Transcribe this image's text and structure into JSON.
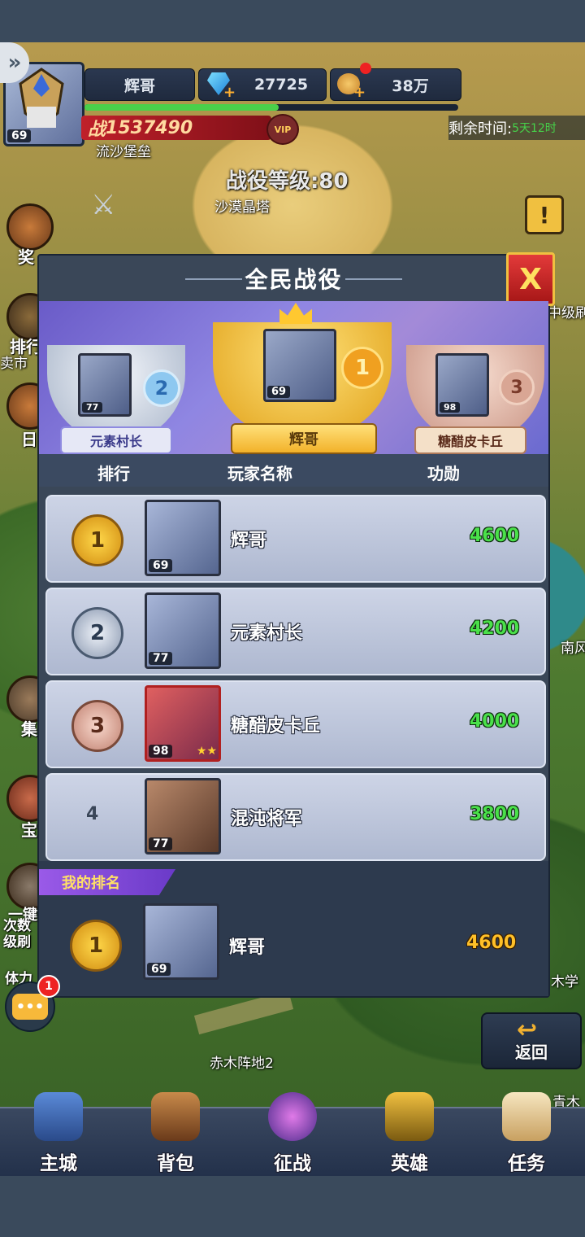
{
  "topbar": {
    "player_name": "辉哥",
    "player_level": "69",
    "diamonds": "27725",
    "gold": "38万",
    "power_prefix": "战",
    "power": "1537490",
    "vip_label": "VIP",
    "remaining_label": "剩余时间:",
    "remaining_value": "5天12时",
    "exp_progress_pct": 52
  },
  "map": {
    "labels": {
      "sand_fort": "流沙堡垒",
      "campaign_level": "战役等级:80",
      "desert_tower": "沙漠晶塔",
      "mid_level": "中级刷",
      "south": "南风",
      "wood_school": "木学",
      "red_wood": "赤木阵地2",
      "blue_wood": "青木",
      "sale": "卖市"
    },
    "left_side": [
      "奖",
      "排行",
      "日",
      "集",
      "宝",
      "一键",
      "次数级刷",
      "体力"
    ]
  },
  "dialog": {
    "title": "全民战役",
    "close_label": "X",
    "podium": [
      {
        "rank": 2,
        "name": "元素村长",
        "level": "77"
      },
      {
        "rank": 1,
        "name": "辉哥",
        "level": "69"
      },
      {
        "rank": 3,
        "name": "糖醋皮卡丘",
        "level": "98"
      }
    ],
    "headers": {
      "rank": "排行",
      "name": "玩家名称",
      "merit": "功勋"
    },
    "rows": [
      {
        "rank": "1",
        "name": "辉哥",
        "level": "69",
        "score": "4600"
      },
      {
        "rank": "2",
        "name": "元素村长",
        "level": "77",
        "score": "4200"
      },
      {
        "rank": "3",
        "name": "糖醋皮卡丘",
        "level": "98",
        "score": "4000"
      },
      {
        "rank": "4",
        "name": "混沌将军",
        "level": "77",
        "score": "3800"
      }
    ],
    "my_rank": {
      "label": "我的排名",
      "rank": "1",
      "name": "辉哥",
      "level": "69",
      "score": "4600"
    }
  },
  "chat": {
    "badge": "1"
  },
  "back": {
    "label": "返回"
  },
  "nav": [
    {
      "label": "主城",
      "icon": "castle-icon"
    },
    {
      "label": "背包",
      "icon": "backpack-icon"
    },
    {
      "label": "征战",
      "icon": "portal-icon"
    },
    {
      "label": "英雄",
      "icon": "helmet-icon"
    },
    {
      "label": "任务",
      "icon": "scroll-icon"
    }
  ]
}
